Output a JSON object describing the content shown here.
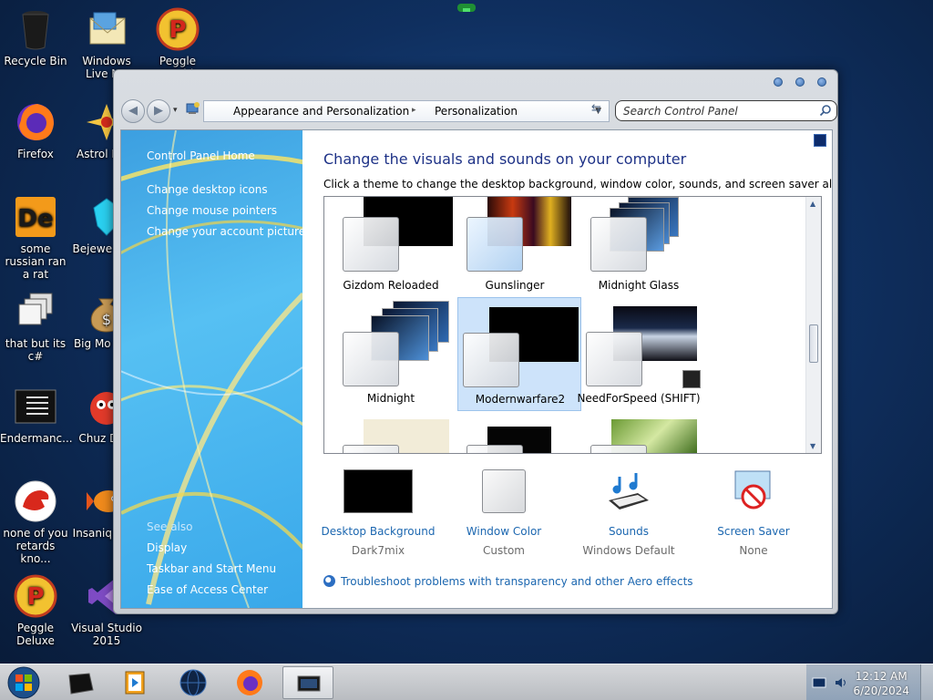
{
  "desktop": {
    "icons": [
      {
        "label": "Recycle Bin",
        "icon": "recycle-bin-icon"
      },
      {
        "label": "Windows Live Ma",
        "icon": "mail-icon"
      },
      {
        "label": "Peggle World",
        "icon": "peggle-icon"
      },
      {
        "label": "Firefox",
        "icon": "firefox-icon"
      },
      {
        "label": "Astrol Delu",
        "icon": "astro-icon"
      },
      {
        "label": "some russian ran a rat",
        "icon": "de-icon"
      },
      {
        "label": "Bejewe Delu",
        "icon": "gem-icon"
      },
      {
        "label": "that but its c#",
        "icon": "windows-stack-icon"
      },
      {
        "label": "Big Mo Delu",
        "icon": "money-bag-icon"
      },
      {
        "label": "Endermanc...",
        "icon": "terminal-icon"
      },
      {
        "label": "Chuz Delu",
        "icon": "red-creature-icon"
      },
      {
        "label": "none of you retards kno...",
        "icon": "dragon-icon"
      },
      {
        "label": "Insaniq Delu",
        "icon": "fish-icon"
      },
      {
        "label": "Peggle Deluxe",
        "icon": "peggle-icon"
      },
      {
        "label": "Visual Studio 2015",
        "icon": "visual-studio-icon"
      }
    ]
  },
  "window": {
    "address": {
      "crumbs": [
        "Appearance and Personalization",
        "Personalization"
      ]
    },
    "search": {
      "placeholder": "Search Control Panel"
    },
    "left_pane": {
      "home": "Control Panel Home",
      "links": [
        "Change desktop icons",
        "Change mouse pointers",
        "Change your account picture"
      ],
      "see_also_label": "See also",
      "see_also": [
        "Display",
        "Taskbar and Start Menu",
        "Ease of Access Center"
      ]
    },
    "main": {
      "title": "Change the visuals and sounds on your computer",
      "description": "Click a theme to change the desktop background, window color, sounds, and screen saver all at once.",
      "themes": [
        {
          "name": "Gizdom Reloaded"
        },
        {
          "name": "Gunslinger"
        },
        {
          "name": "Midnight Glass"
        },
        {
          "name": "Midnight"
        },
        {
          "name": "Modernwarfare2",
          "selected": true
        },
        {
          "name": "NeedForSpeed (SHIFT)"
        }
      ],
      "bottom": [
        {
          "label": "Desktop Background",
          "value": "Dark7mix"
        },
        {
          "label": "Window Color",
          "value": "Custom"
        },
        {
          "label": "Sounds",
          "value": "Windows Default"
        },
        {
          "label": "Screen Saver",
          "value": "None"
        }
      ],
      "troubleshoot": "Troubleshoot problems with transparency and other Aero effects"
    }
  },
  "taskbar": {
    "time": "12:12 AM",
    "date": "6/20/2024",
    "apps": [
      "black-box-app-icon",
      "media-player-icon",
      "globe-app-icon",
      "firefox-icon",
      "explorer-window-icon"
    ]
  },
  "colors": {
    "link": "#1c67b0",
    "title": "#1e3287",
    "selection": "#cde3fa"
  }
}
